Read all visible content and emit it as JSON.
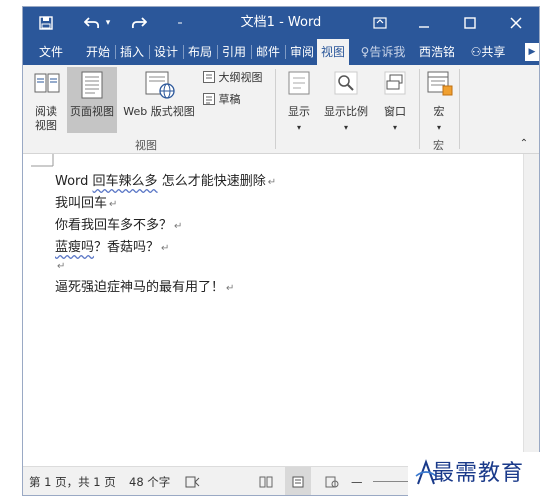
{
  "window": {
    "title": "文档1 - Word"
  },
  "menu": {
    "items": [
      "文件",
      "开始",
      "插入",
      "设计",
      "布局",
      "引用",
      "邮件",
      "审阅",
      "视图"
    ],
    "tell_me": "告诉我",
    "user": "西浩铭",
    "share": "共享"
  },
  "ribbon": {
    "read_mode": [
      "阅读",
      "视图"
    ],
    "print_layout": "页面视图",
    "web_layout": "Web 版式视图",
    "outline": "大纲视图",
    "draft": "草稿",
    "show": "显示",
    "zoom": "显示比例",
    "window": "窗口",
    "macros": "宏",
    "group_views": "视图",
    "group_macros": "宏"
  },
  "document": {
    "lines": [
      {
        "parts": [
          "Word ",
          "回车辣么多",
          " 怎么才能快速删除"
        ]
      },
      {
        "text": "我叫回车"
      },
      {
        "text": "你看我回车多不多？"
      },
      {
        "parts": [
          "蓝瘦吗",
          "？香菇吗？"
        ]
      },
      {
        "text": ""
      },
      {
        "text": "逼死强迫症神马的最有用了！"
      }
    ],
    "paragraph_mark": "↵"
  },
  "status": {
    "page": "第 1 页，共 1 页",
    "words": "48 个字"
  },
  "watermark": {
    "text": "最需教育"
  },
  "colors": {
    "brand": "#2b579a",
    "accent_text": "#1a3a8a"
  }
}
